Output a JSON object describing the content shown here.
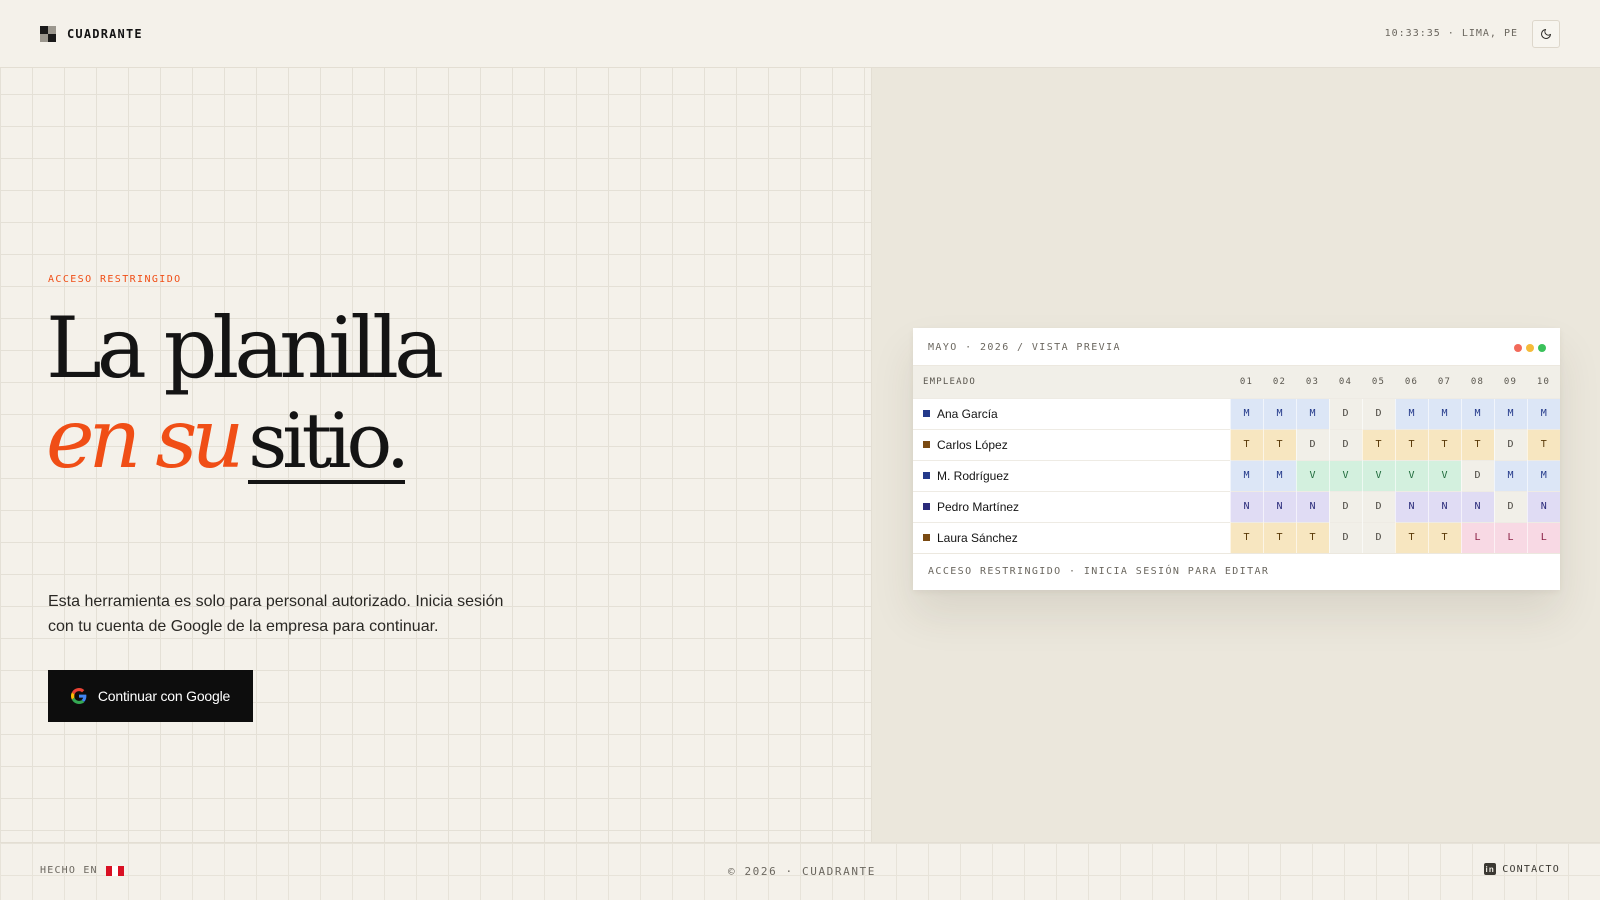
{
  "header": {
    "brand": "CUADRANTE",
    "clock": "10:33:35 · LIMA, PE",
    "theme_icon": "moon-icon"
  },
  "hero": {
    "eyebrow": "ACCESO RESTRINGIDO",
    "headline_line1": "La planilla",
    "headline_accent": "en su",
    "headline_underlined": "sitio.",
    "lead": "Esta herramienta es solo para personal autorizado. Inicia sesión con tu cuenta de Google de la empresa para continuar.",
    "cta_label": "Continuar con Google",
    "cta_icon": "google-icon"
  },
  "preview": {
    "title": "MAYO · 2026 / VISTA PREVIA",
    "column_header": "EMPLEADO",
    "days": [
      "01",
      "02",
      "03",
      "04",
      "05",
      "06",
      "07",
      "08",
      "09",
      "10"
    ],
    "employees": [
      {
        "name": "Ana García",
        "color": "#23398a",
        "shifts": [
          "M",
          "M",
          "M",
          "D",
          "D",
          "M",
          "M",
          "M",
          "M",
          "M"
        ]
      },
      {
        "name": "Carlos López",
        "color": "#7a4a12",
        "shifts": [
          "T",
          "T",
          "D",
          "D",
          "T",
          "T",
          "T",
          "T",
          "D",
          "T"
        ]
      },
      {
        "name": "M. Rodríguez",
        "color": "#23398a",
        "shifts": [
          "M",
          "M",
          "V",
          "V",
          "V",
          "V",
          "V",
          "D",
          "M",
          "M"
        ]
      },
      {
        "name": "Pedro Martínez",
        "color": "#2a2a7a",
        "shifts": [
          "N",
          "N",
          "N",
          "D",
          "D",
          "N",
          "N",
          "N",
          "D",
          "N"
        ]
      },
      {
        "name": "Laura Sánchez",
        "color": "#7a4a12",
        "shifts": [
          "T",
          "T",
          "T",
          "D",
          "D",
          "T",
          "T",
          "L",
          "L",
          "L"
        ]
      }
    ],
    "shift_colors": {
      "M": {
        "bg": "#dce6f6",
        "fg": "#23398a"
      },
      "T": {
        "bg": "#f7e6c0",
        "fg": "#5a3a08"
      },
      "D": {
        "bg": "#f1efe8",
        "fg": "#4a4740"
      },
      "V": {
        "bg": "#d3f0de",
        "fg": "#1d6a3a"
      },
      "N": {
        "bg": "#e0dcf4",
        "fg": "#2a2a7a"
      },
      "L": {
        "bg": "#f8d9e4",
        "fg": "#8a1e44"
      }
    },
    "footer": "ACCESO RESTRINGIDO · INICIA SESIÓN PARA EDITAR"
  },
  "footer": {
    "made_in": "HECHO EN",
    "flag_icon": "peru-flag-icon",
    "copyright": "© 2026 · CUADRANTE",
    "contact": "CONTACTO",
    "contact_icon": "linkedin-icon"
  },
  "colors": {
    "accent": "#f04e16",
    "background": "#f4f1ea",
    "panel": "#ebe7dc"
  }
}
